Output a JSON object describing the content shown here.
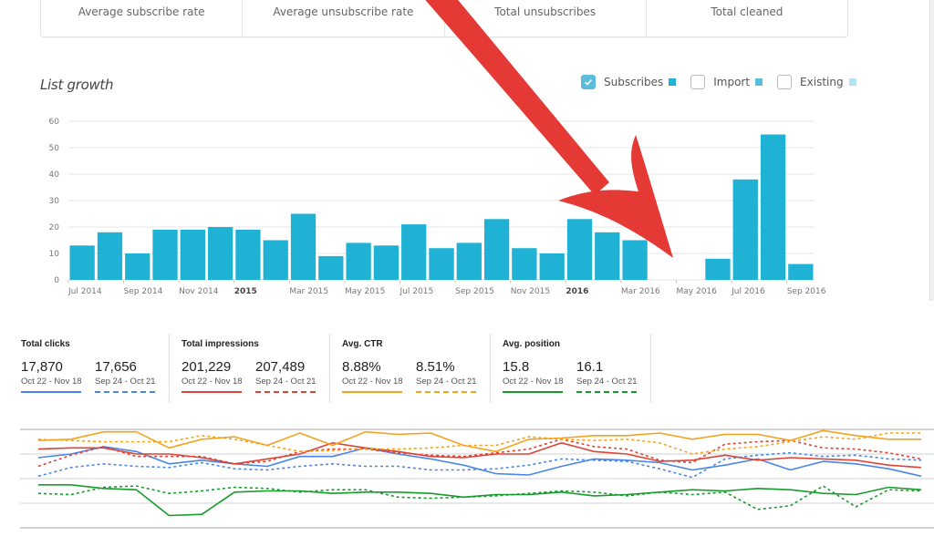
{
  "stats_card": {
    "cells": [
      {
        "label": "Average subscribe rate"
      },
      {
        "label": "Average unsubscribe rate"
      },
      {
        "label": "Total unsubscribes"
      },
      {
        "label": "Total cleaned"
      }
    ]
  },
  "list_growth": {
    "title": "List growth",
    "legend": [
      {
        "label": "Subscribes",
        "checked": true,
        "color": "#1fb2d4"
      },
      {
        "label": "Import",
        "checked": false,
        "color": "#5bbcdc"
      },
      {
        "label": "Existing",
        "checked": false,
        "color": "#b3e3ef"
      }
    ]
  },
  "metrics": [
    {
      "title": "Total clicks",
      "color": "#4a86e8",
      "current": {
        "value": "17,870",
        "range": "Oct 22 - Nov 18"
      },
      "previous": {
        "value": "17,656",
        "range": "Sep 24 - Oct 21"
      }
    },
    {
      "title": "Total impressions",
      "color": "#db4437",
      "current": {
        "value": "201,229",
        "range": "Oct 22 - Nov 18"
      },
      "previous": {
        "value": "207,489",
        "range": "Sep 24 - Oct 21"
      }
    },
    {
      "title": "Avg. CTR",
      "color": "#f4a31f",
      "current": {
        "value": "8.88%",
        "range": "Oct 22 - Nov 18"
      },
      "previous": {
        "value": "8.51%",
        "range": "Sep 24 - Oct 21"
      }
    },
    {
      "title": "Avg. position",
      "color": "#189a2d",
      "current": {
        "value": "15.8",
        "range": "Oct 22 - Nov 18"
      },
      "previous": {
        "value": "16.1",
        "range": "Sep 24 - Oct 21"
      }
    }
  ],
  "chart_data": [
    {
      "type": "bar",
      "title": "List growth",
      "xlabel": "",
      "ylabel": "",
      "ylim": [
        0,
        60
      ],
      "yticks": [
        0,
        10,
        20,
        30,
        40,
        50,
        60
      ],
      "grid": true,
      "categories": [
        "Jul 2014",
        "Aug 2014",
        "Sep 2014",
        "Oct 2014",
        "Nov 2014",
        "Dec 2014",
        "Jan 2015",
        "Feb 2015",
        "Mar 2015",
        "Apr 2015",
        "May 2015",
        "Jun 2015",
        "Jul 2015",
        "Aug 2015",
        "Sep 2015",
        "Oct 2015",
        "Nov 2015",
        "Dec 2015",
        "Jan 2016",
        "Feb 2016",
        "Mar 2016",
        "Apr 2016",
        "May 2016",
        "Jun 2016",
        "Jul 2016",
        "Aug 2016",
        "Sep 2016"
      ],
      "xtick_labels": [
        {
          "index": 0,
          "label": "Jul 2014",
          "bold": false
        },
        {
          "index": 2,
          "label": "Sep 2014",
          "bold": false
        },
        {
          "index": 4,
          "label": "Nov 2014",
          "bold": false
        },
        {
          "index": 6,
          "label": "2015",
          "bold": true
        },
        {
          "index": 8,
          "label": "Mar 2015",
          "bold": false
        },
        {
          "index": 10,
          "label": "May 2015",
          "bold": false
        },
        {
          "index": 12,
          "label": "Jul 2015",
          "bold": false
        },
        {
          "index": 14,
          "label": "Sep 2015",
          "bold": false
        },
        {
          "index": 16,
          "label": "Nov 2015",
          "bold": false
        },
        {
          "index": 18,
          "label": "2016",
          "bold": true
        },
        {
          "index": 20,
          "label": "Mar 2016",
          "bold": false
        },
        {
          "index": 22,
          "label": "May 2016",
          "bold": false
        },
        {
          "index": 24,
          "label": "Jul 2016",
          "bold": false
        },
        {
          "index": 26,
          "label": "Sep 2016",
          "bold": false
        }
      ],
      "series": [
        {
          "name": "Subscribes",
          "color": "#1fb2d4",
          "values": [
            13,
            18,
            10,
            19,
            19,
            20,
            19,
            15,
            25,
            9,
            14,
            13,
            21,
            12,
            14,
            23,
            12,
            10,
            23,
            18,
            15,
            0,
            0,
            8,
            38,
            55,
            6
          ]
        }
      ]
    },
    {
      "type": "line",
      "title": "",
      "xlabel": "",
      "ylabel": "",
      "ylim": [
        0,
        4
      ],
      "note": "relative scale; no axis labels shown",
      "grid": true,
      "series": [
        {
          "name": "Total clicks (Oct 22 - Nov 18)",
          "color": "#4a86e8",
          "dashed": false,
          "values": [
            2.85,
            3.0,
            3.3,
            3.1,
            2.6,
            2.75,
            2.6,
            2.5,
            2.9,
            2.9,
            3.25,
            3.0,
            2.8,
            2.55,
            2.2,
            2.15,
            2.5,
            2.8,
            2.75,
            2.65,
            2.35,
            2.55,
            2.8,
            2.35,
            2.7,
            2.6,
            2.4,
            2.1
          ]
        },
        {
          "name": "Total clicks (Sep 24 - Oct 21)",
          "color": "#4a86e8",
          "dashed": true,
          "values": [
            2.1,
            2.45,
            2.6,
            2.5,
            2.45,
            2.65,
            2.4,
            2.35,
            2.5,
            2.6,
            2.5,
            2.5,
            2.35,
            2.35,
            2.4,
            2.55,
            2.8,
            2.75,
            2.7,
            2.4,
            2.05,
            2.8,
            2.95,
            3.05,
            2.9,
            2.95,
            2.8,
            2.75
          ]
        },
        {
          "name": "Total impressions (Oct 22 - Nov 18)",
          "color": "#db4437",
          "dashed": false,
          "values": [
            3.2,
            3.25,
            3.25,
            3.0,
            3.0,
            2.85,
            2.6,
            2.8,
            3.0,
            3.45,
            3.25,
            3.1,
            2.9,
            2.85,
            3.0,
            3.0,
            3.45,
            3.1,
            3.0,
            2.7,
            2.75,
            2.95,
            2.75,
            2.85,
            2.8,
            2.75,
            2.55,
            2.45
          ]
        },
        {
          "name": "Total impressions (Sep 24 - Oct 21)",
          "color": "#db4437",
          "dashed": true,
          "values": [
            2.5,
            2.95,
            3.3,
            2.9,
            2.9,
            2.9,
            2.6,
            2.7,
            3.1,
            3.2,
            3.2,
            3.05,
            2.95,
            2.9,
            3.05,
            3.2,
            3.6,
            3.3,
            3.2,
            2.75,
            2.65,
            3.4,
            3.5,
            3.55,
            3.25,
            3.2,
            3.05,
            2.8
          ]
        },
        {
          "name": "Avg. CTR (Oct 22 - Nov 18)",
          "color": "#f4a31f",
          "dashed": false,
          "values": [
            3.55,
            3.6,
            3.9,
            3.9,
            3.25,
            3.6,
            3.7,
            3.35,
            3.85,
            3.35,
            3.9,
            3.8,
            3.85,
            3.35,
            3.1,
            3.6,
            3.65,
            3.75,
            3.75,
            3.85,
            3.6,
            3.8,
            3.8,
            3.55,
            3.95,
            3.75,
            3.6,
            3.6
          ]
        },
        {
          "name": "Avg. CTR (Sep 24 - Oct 21)",
          "color": "#f4a31f",
          "dashed": true,
          "values": [
            3.6,
            3.55,
            3.5,
            3.5,
            3.5,
            3.75,
            3.6,
            3.35,
            3.1,
            3.15,
            3.2,
            3.2,
            3.25,
            3.35,
            3.35,
            3.7,
            3.6,
            3.55,
            3.6,
            3.45,
            3.0,
            3.2,
            3.3,
            3.5,
            3.7,
            3.6,
            3.85,
            3.85
          ]
        },
        {
          "name": "Avg. position (Oct 22 - Nov 18)",
          "color": "#189a2d",
          "dashed": false,
          "values": [
            1.75,
            1.75,
            1.6,
            1.55,
            0.5,
            0.55,
            1.45,
            1.5,
            1.5,
            1.4,
            1.45,
            1.45,
            1.4,
            1.25,
            1.35,
            1.35,
            1.45,
            1.3,
            1.35,
            1.45,
            1.55,
            1.5,
            1.6,
            1.55,
            1.4,
            1.35,
            1.65,
            1.55
          ]
        },
        {
          "name": "Avg. position (Sep 24 - Oct 21)",
          "color": "#189a2d",
          "dashed": true,
          "values": [
            1.4,
            1.35,
            1.65,
            1.7,
            1.4,
            1.5,
            1.65,
            1.6,
            1.45,
            1.55,
            1.55,
            1.25,
            1.2,
            1.25,
            1.3,
            1.4,
            1.5,
            1.45,
            1.3,
            1.45,
            1.35,
            1.45,
            0.75,
            0.9,
            1.7,
            0.85,
            1.55,
            1.5
          ]
        }
      ]
    }
  ],
  "annotation": {
    "arrow_color": "#e53935"
  }
}
